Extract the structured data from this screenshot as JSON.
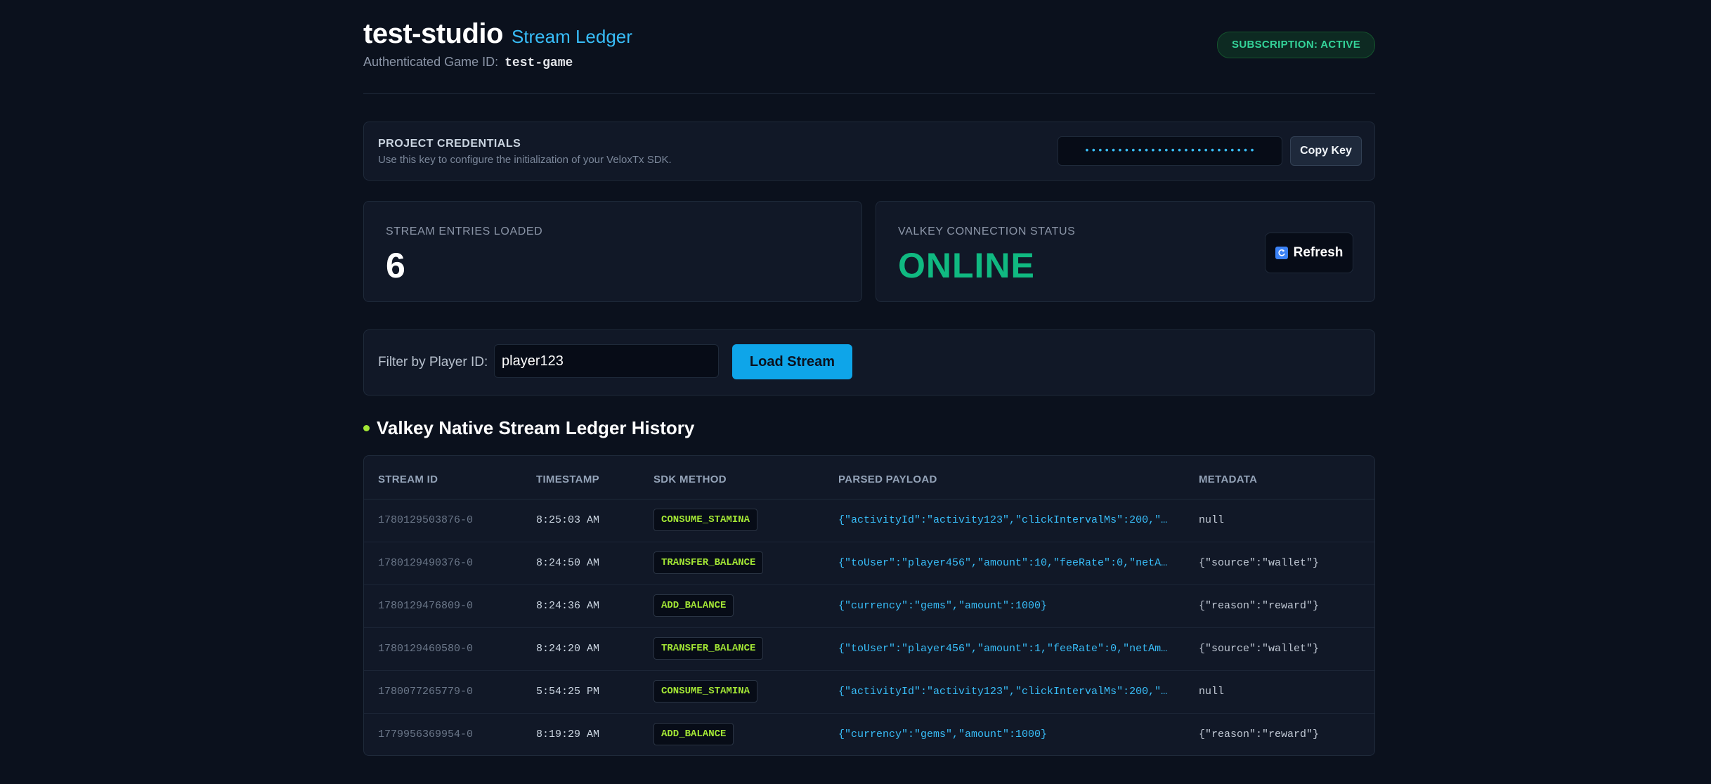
{
  "header": {
    "studio_name": "test-studio",
    "app_title": "Stream Ledger",
    "auth_label": "Authenticated Game ID:",
    "game_id": "test-game",
    "subscription_badge": "SUBSCRIPTION: ACTIVE"
  },
  "credentials": {
    "title": "PROJECT CREDENTIALS",
    "description": "Use this key to configure the initialization of your VeloxTx SDK.",
    "key_masked": "••••••••••••••••••••••••••",
    "copy_label": "Copy Key"
  },
  "stats": {
    "entries_label": "STREAM ENTRIES LOADED",
    "entries_value": "6",
    "status_label": "VALKEY CONNECTION STATUS",
    "status_value": "ONLINE",
    "refresh_label": "Refresh",
    "refresh_icon": "refresh-icon"
  },
  "filter": {
    "label": "Filter by Player ID:",
    "value": "player123",
    "load_label": "Load Stream"
  },
  "history": {
    "title": "Valkey Native Stream Ledger History",
    "columns": [
      "STREAM ID",
      "TIMESTAMP",
      "SDK METHOD",
      "PARSED PAYLOAD",
      "METADATA"
    ],
    "rows": [
      {
        "id": "1780129503876-0",
        "ts": "8:25:03 AM",
        "method": "CONSUME_STAMINA",
        "payload": "{\"activityId\":\"activity123\",\"clickIntervalMs\":200,\"…",
        "meta": "null"
      },
      {
        "id": "1780129490376-0",
        "ts": "8:24:50 AM",
        "method": "TRANSFER_BALANCE",
        "payload": "{\"toUser\":\"player456\",\"amount\":10,\"feeRate\":0,\"netA…",
        "meta": "{\"source\":\"wallet\"}"
      },
      {
        "id": "1780129476809-0",
        "ts": "8:24:36 AM",
        "method": "ADD_BALANCE",
        "payload": "{\"currency\":\"gems\",\"amount\":1000}",
        "meta": "{\"reason\":\"reward\"}"
      },
      {
        "id": "1780129460580-0",
        "ts": "8:24:20 AM",
        "method": "TRANSFER_BALANCE",
        "payload": "{\"toUser\":\"player456\",\"amount\":1,\"feeRate\":0,\"netAm…",
        "meta": "{\"source\":\"wallet\"}"
      },
      {
        "id": "1780077265779-0",
        "ts": "5:54:25 PM",
        "method": "CONSUME_STAMINA",
        "payload": "{\"activityId\":\"activity123\",\"clickIntervalMs\":200,\"…",
        "meta": "null"
      },
      {
        "id": "1779956369954-0",
        "ts": "8:19:29 AM",
        "method": "ADD_BALANCE",
        "payload": "{\"currency\":\"gems\",\"amount\":1000}",
        "meta": "{\"reason\":\"reward\"}"
      }
    ]
  },
  "colors": {
    "accent": "#0ea5e9",
    "online": "#10b981",
    "method": "#a3e635",
    "background": "#0b111d"
  }
}
